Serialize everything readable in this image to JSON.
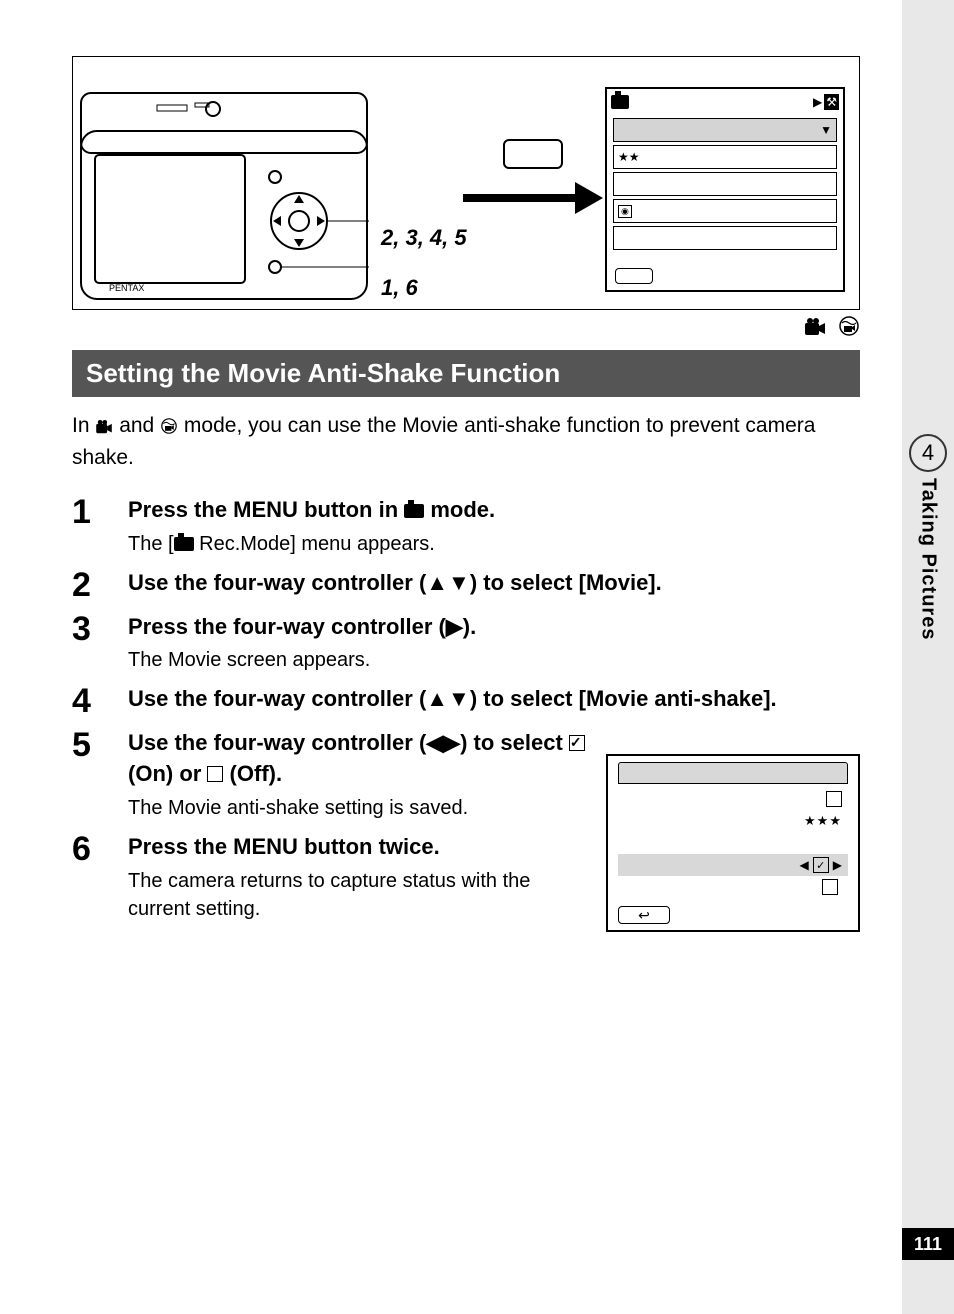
{
  "side": {
    "chapter_num": "4",
    "chapter_title": "Taking Pictures"
  },
  "page_number": "111",
  "figure": {
    "annot_controller": "2, 3, 4, 5",
    "annot_ok": "1, 6",
    "camera_logo": "PENTAX",
    "lcd_top": {
      "menu_rows": [
        {
          "icon": "camera"
        },
        {
          "text": "",
          "arrow_down": true,
          "highlight": true
        },
        {
          "text": "★★"
        },
        {
          "text": "",
          "icon": "metering"
        },
        {
          "text": "⦿"
        }
      ]
    }
  },
  "mode_icons_alt": "movie-mode underwater-movie-mode",
  "heading": "Setting the Movie Anti-Shake Function",
  "intro_pre": "In ",
  "intro_mid": " and ",
  "intro_post": " mode, you can use the Movie anti-shake function to prevent camera shake.",
  "steps": {
    "s1": {
      "n": "1",
      "t_pre": "Press the ",
      "t_menu": "MENU",
      "t_mid": " button in ",
      "t_post": " mode.",
      "sub_pre": "The [",
      "sub_post": " Rec.Mode] menu appears."
    },
    "s2": {
      "n": "2",
      "t": "Use the four-way controller (▲▼) to select [Movie]."
    },
    "s3": {
      "n": "3",
      "t": "Press the four-way controller (▶).",
      "sub": "The Movie screen appears."
    },
    "s4": {
      "n": "4",
      "t": "Use the four-way controller (▲▼) to select [Movie anti-shake]."
    },
    "s5": {
      "n": "5",
      "t_pre": "Use the four-way controller (◀▶) to select ",
      "t_on": " (On) or ",
      "t_off": " (Off).",
      "sub": "The Movie anti-shake setting is saved."
    },
    "s6": {
      "n": "6",
      "t_pre": "Press the ",
      "t_menu": "MENU",
      "t_post": " button twice.",
      "sub": "The camera returns to capture status with the current setting."
    }
  },
  "lcd2": {
    "stars": "★★★",
    "back_glyph": "↩"
  }
}
